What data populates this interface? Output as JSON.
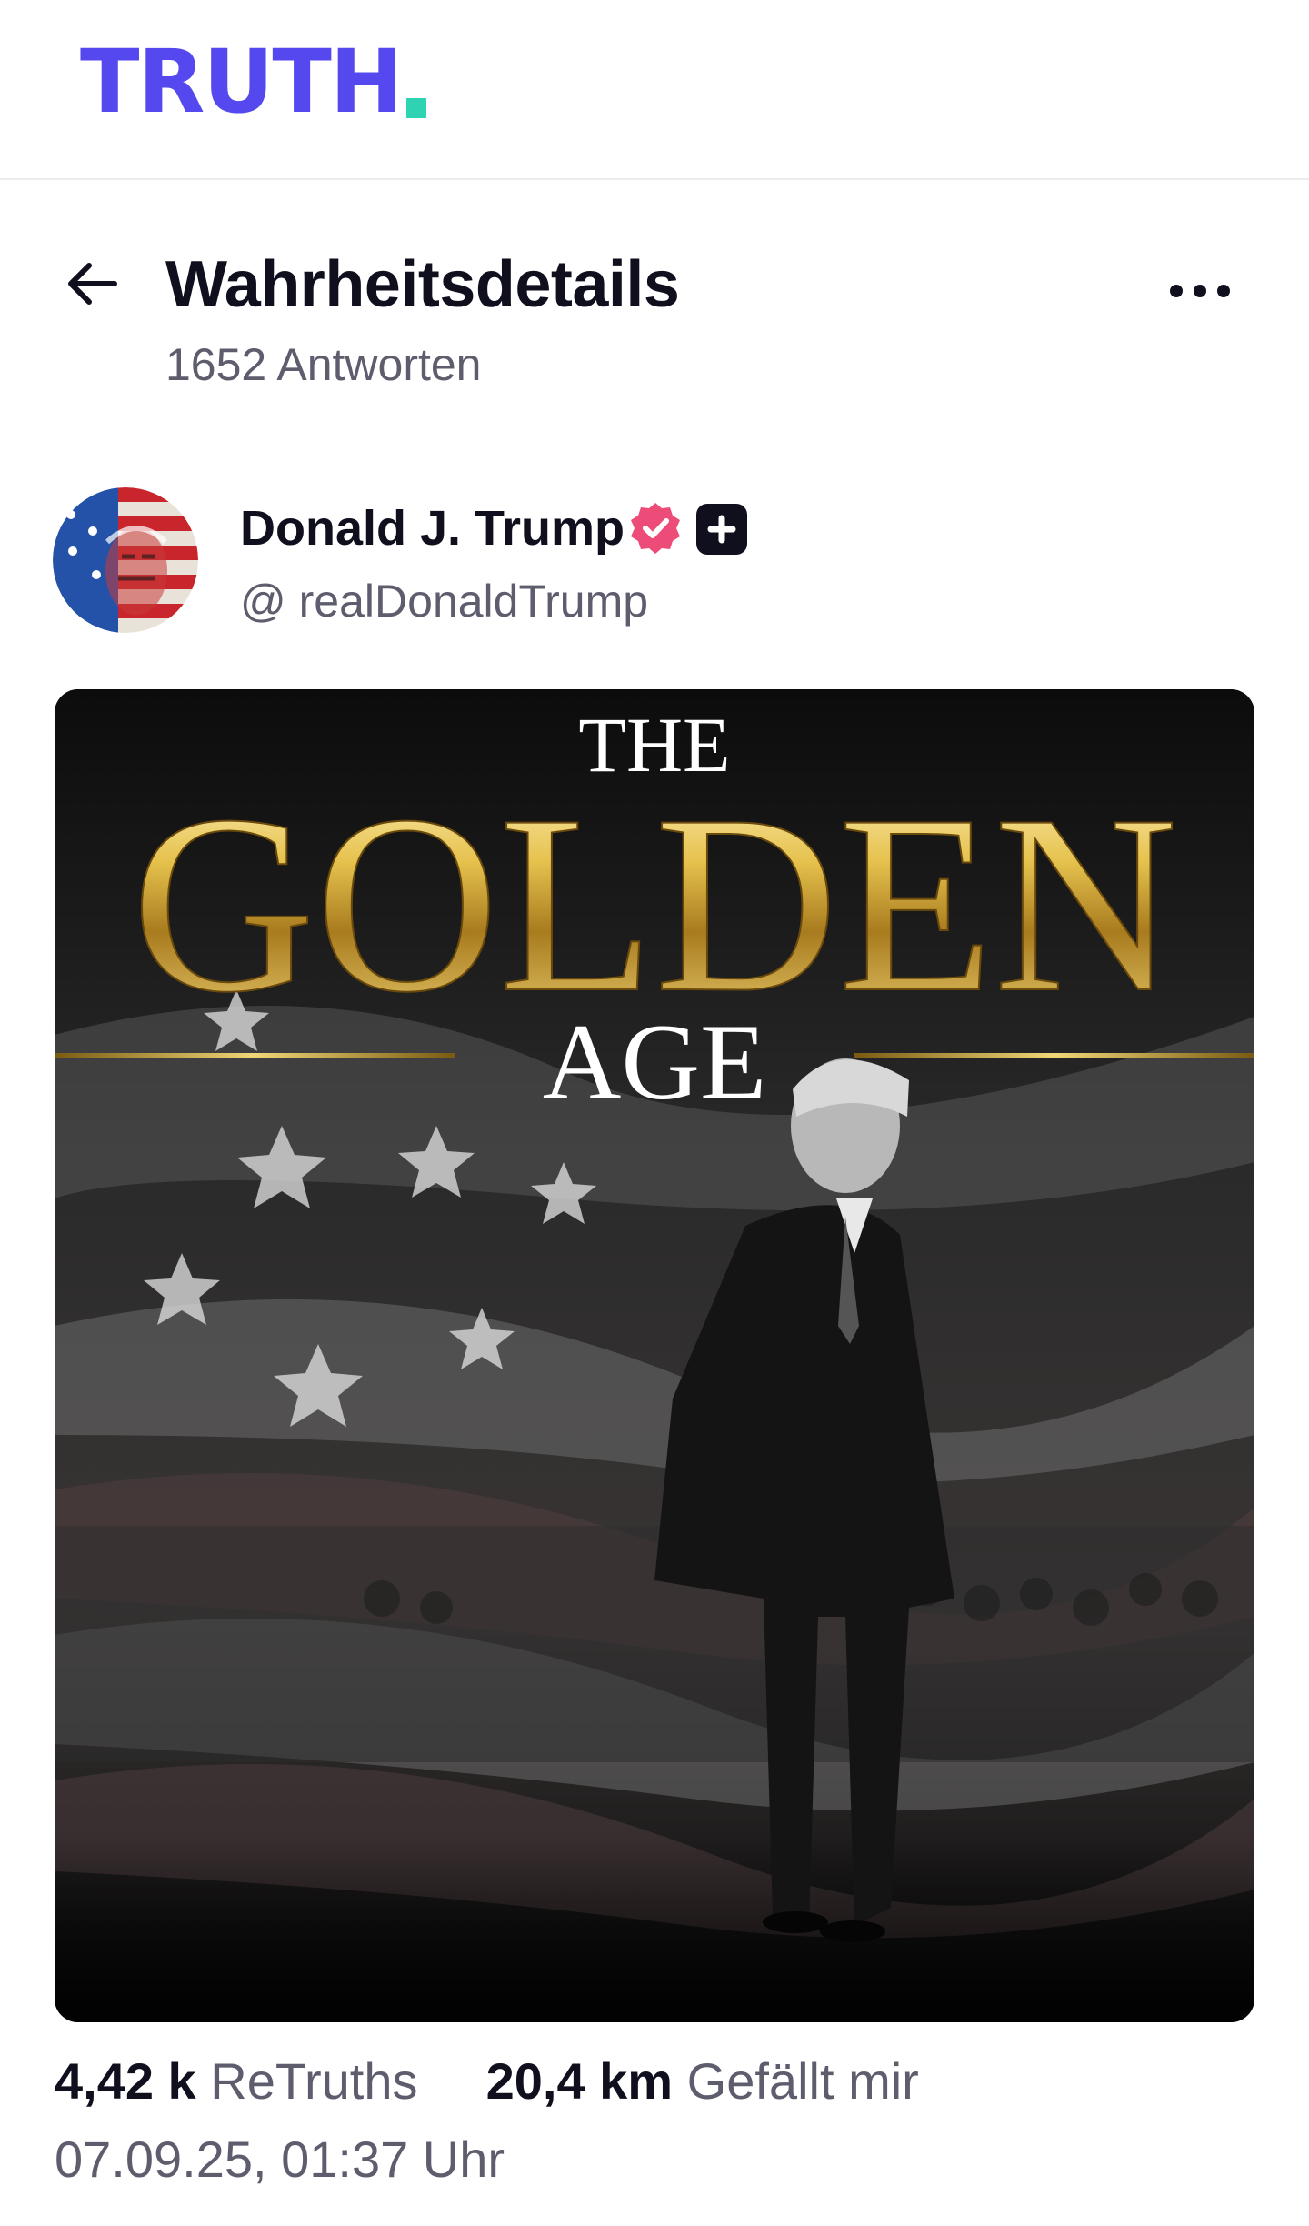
{
  "brand": {
    "logo_text": "TRUTH",
    "accent": "#5448ee",
    "dot_color": "#2ed3b4"
  },
  "header": {
    "back_icon": "arrow-left-icon",
    "title": "Wahrheitsdetails",
    "replies": "1652 Antworten",
    "more_icon": "more-horizontal-icon"
  },
  "author": {
    "name": "Donald J. Trump",
    "handle": "@ realDonaldTrump",
    "verified_icon": "verified-badge-icon",
    "verified_color": "#ec4c77",
    "plus_icon": "plus-badge-icon"
  },
  "post": {
    "image_text": {
      "line1": "THE",
      "line2": "GOLDEN",
      "line3": "AGE"
    },
    "stats": {
      "retruths_count": "4,42 k",
      "retruths_label": "ReTruths",
      "likes_count": "20,4 km",
      "likes_label": "Gefällt mir"
    },
    "timestamp": "07.09.25, 01:37 Uhr"
  }
}
